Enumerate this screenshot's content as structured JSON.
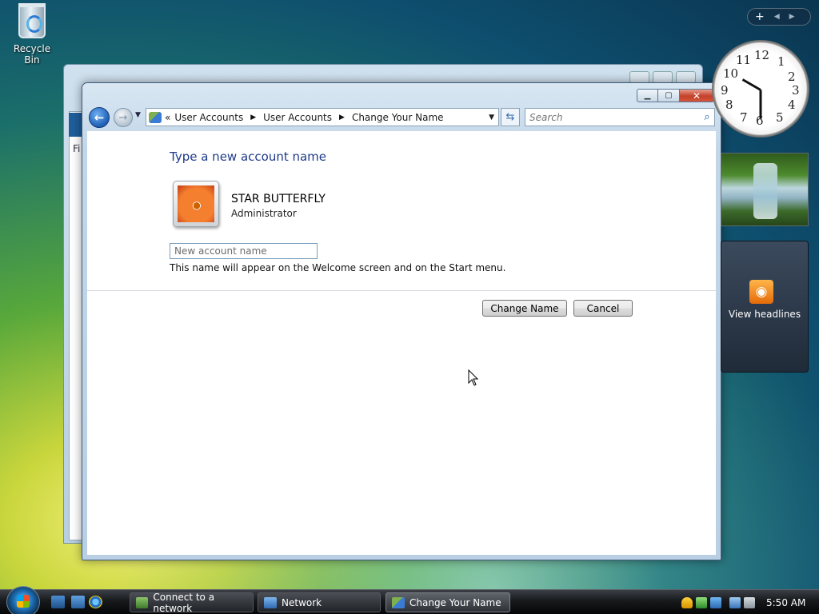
{
  "desktop": {
    "recycle_bin_label": "Recycle Bin"
  },
  "window": {
    "title": "Change Your Name",
    "breadcrumb": [
      "User Accounts",
      "User Accounts",
      "Change Your Name"
    ],
    "breadcrumb_prefix": "«",
    "search_placeholder": "Search",
    "heading": "Type a new account name",
    "user_name": "STAR BUTTERFLY",
    "user_role": "Administrator",
    "name_input_placeholder": "New account name",
    "help_text": "This name will appear on the Welcome screen and on the Start menu.",
    "change_button": "Change Name",
    "cancel_button": "Cancel"
  },
  "background_window": {
    "partial_label": "Fi"
  },
  "sidebar": {
    "feed_label": "View headlines",
    "clock_numbers": [
      "12",
      "1",
      "2",
      "3",
      "4",
      "5",
      "6",
      "7",
      "8",
      "9",
      "10",
      "11"
    ]
  },
  "taskbar": {
    "tasks": [
      "Connect to a network",
      "Network",
      "Change Your Name"
    ],
    "clock": "5:50 AM"
  },
  "colors": {
    "heading": "#1e3a8a",
    "address_bar_border": "#8aa2b8",
    "close_button": "#c2412a",
    "rss_orange": "#e46b09"
  }
}
